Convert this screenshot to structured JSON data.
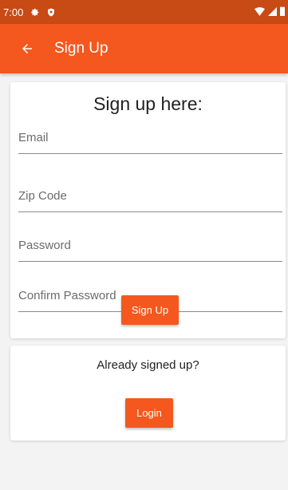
{
  "status_bar": {
    "time": "7:00",
    "icons": [
      "settings-icon",
      "shield-icon",
      "wifi-icon",
      "signal-icon",
      "battery-icon"
    ]
  },
  "app_bar": {
    "title": "Sign Up",
    "back_icon": "arrow-back-icon"
  },
  "signup_form": {
    "heading": "Sign up here:",
    "email_placeholder": "Email",
    "email_value": "",
    "zip_placeholder": "Zip Code",
    "zip_value": "",
    "password_placeholder": "Password",
    "password_value": "",
    "confirm_password_placeholder": "Confirm Password",
    "confirm_password_value": "",
    "submit_label": "Sign Up"
  },
  "login_section": {
    "prompt": "Already signed up?",
    "button_label": "Login"
  },
  "colors": {
    "primary": "#f4581e",
    "status_bar": "#c84a14",
    "background": "#f3f3f3"
  }
}
